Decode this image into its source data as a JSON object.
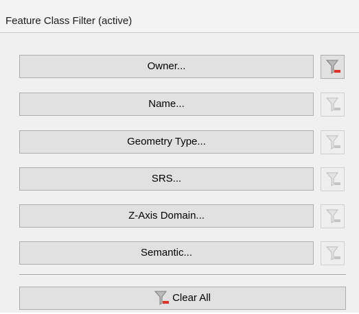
{
  "header": {
    "title": "Feature Class Filter (active)"
  },
  "filters": [
    {
      "label": "Owner...",
      "clear_icon": "filter-clear-icon",
      "active": true
    },
    {
      "label": "Name...",
      "clear_icon": "filter-clear-icon",
      "active": false
    },
    {
      "label": "Geometry Type...",
      "clear_icon": "filter-clear-icon",
      "active": false
    },
    {
      "label": "SRS...",
      "clear_icon": "filter-clear-icon",
      "active": false
    },
    {
      "label": "Z-Axis Domain...",
      "clear_icon": "filter-clear-icon",
      "active": false
    },
    {
      "label": "Semantic...",
      "clear_icon": "filter-clear-icon",
      "active": false
    }
  ],
  "clear_all": {
    "label": "Clear All",
    "icon": "filter-clear-icon"
  },
  "colors": {
    "active_funnel": "#8a8a8a",
    "inactive_funnel": "#c4c4c4",
    "active_bar": "#e0302a",
    "inactive_bar": "#c4c4c4"
  }
}
